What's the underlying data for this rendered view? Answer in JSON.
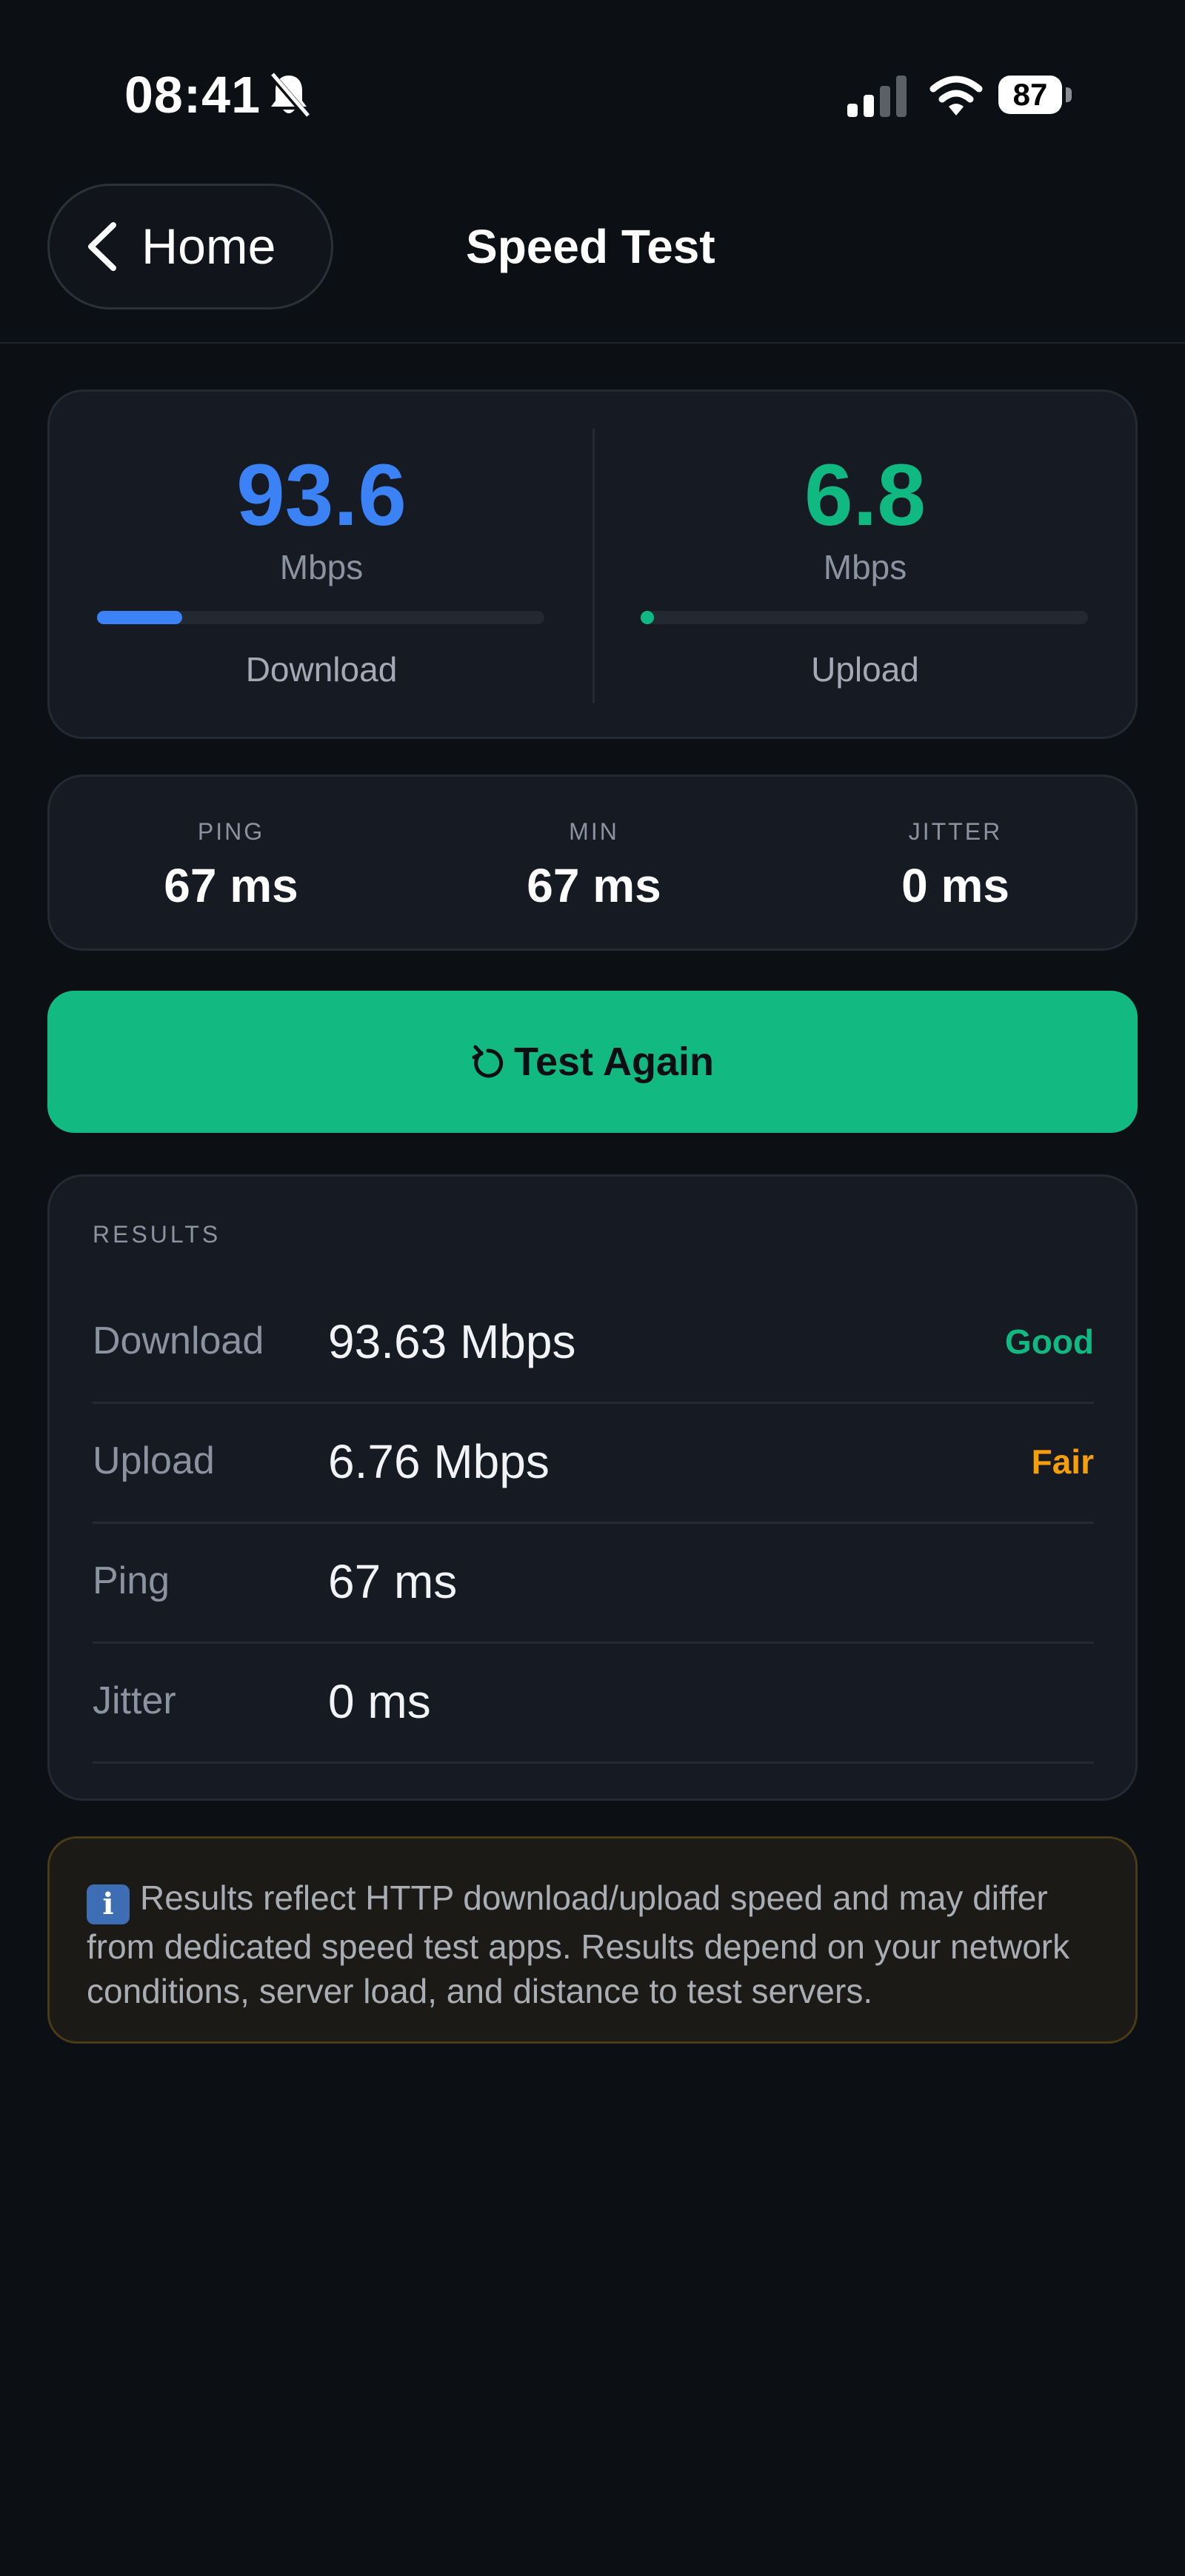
{
  "status_bar": {
    "time": "08:41",
    "battery": "87"
  },
  "header": {
    "back_label": "Home",
    "title": "Speed Test"
  },
  "speed": {
    "download": {
      "value": "93.6",
      "unit": "Mbps",
      "label": "Download",
      "progress": 0.19,
      "color": "#3b82f6"
    },
    "upload": {
      "value": "6.8",
      "unit": "Mbps",
      "label": "Upload",
      "progress": 0.01,
      "color": "#10b981"
    }
  },
  "stats": [
    {
      "label": "PING",
      "value": "67 ms"
    },
    {
      "label": "MIN",
      "value": "67 ms"
    },
    {
      "label": "JITTER",
      "value": "0 ms"
    }
  ],
  "test_button": {
    "label": "Test Again"
  },
  "results": {
    "title": "RESULTS",
    "rows": [
      {
        "key": "Download",
        "value": "93.63 Mbps",
        "rating": "Good",
        "rating_color": "#10b981"
      },
      {
        "key": "Upload",
        "value": "6.76 Mbps",
        "rating": "Fair",
        "rating_color": "#f59e0b"
      },
      {
        "key": "Ping",
        "value": "67 ms",
        "rating": "",
        "rating_color": ""
      },
      {
        "key": "Jitter",
        "value": "0 ms",
        "rating": "",
        "rating_color": ""
      }
    ]
  },
  "info": {
    "icon": "info-icon",
    "text": "Results reflect HTTP download/upload speed and may differ from dedicated speed test apps. Results depend on your network conditions, server load, and distance to test servers."
  },
  "colors": {
    "accent": "#10b981",
    "background": "#0c0f14"
  }
}
